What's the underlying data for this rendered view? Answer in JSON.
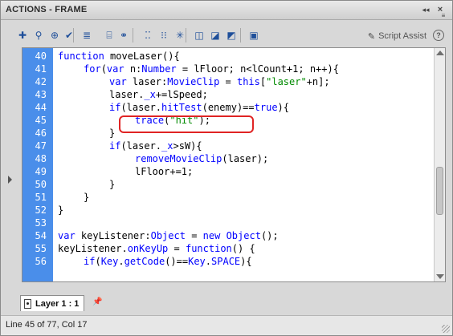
{
  "panel": {
    "title": "ACTIONS - FRAME",
    "collapse_glyph": "◂◂",
    "close_glyph": "×",
    "menu_glyph": "≡"
  },
  "toolbar": {
    "buttons": [
      {
        "name": "add-statement-icon",
        "glyph": "✚"
      },
      {
        "name": "find-icon",
        "glyph": "⚲"
      },
      {
        "name": "target-path-icon",
        "glyph": "⊕"
      },
      {
        "name": "check-syntax-icon",
        "glyph": "✔"
      },
      {
        "name": "auto-format-icon",
        "glyph": "≣"
      },
      {
        "name": "code-hint-icon",
        "glyph": "⌸"
      },
      {
        "name": "debug-options-icon",
        "glyph": "⚭"
      },
      {
        "name": "collapse-between-braces-icon",
        "glyph": "⁚⁚"
      },
      {
        "name": "collapse-selection-icon",
        "glyph": "⁝⁝"
      },
      {
        "name": "expand-all-icon",
        "glyph": "✳"
      },
      {
        "name": "apply-block-comment-icon",
        "glyph": "◫"
      },
      {
        "name": "apply-line-comment-icon",
        "glyph": "◪"
      },
      {
        "name": "remove-comment-icon",
        "glyph": "◩"
      },
      {
        "name": "show-hide-toolbox-icon",
        "glyph": "▣"
      }
    ],
    "script_assist_label": "Script Assist",
    "help_glyph": "?"
  },
  "editor": {
    "lines": [
      {
        "num": "40",
        "indent": 0,
        "html": "<span class='kw'>function</span> moveLaser(){"
      },
      {
        "num": "41",
        "indent": 1,
        "html": "<span class='kw'>for</span>(<span class='kw'>var</span> n:<span class='kw'>Number</span> = lFloor; n&lt;lCount+1; n++){"
      },
      {
        "num": "42",
        "indent": 2,
        "html": "<span class='kw'>var</span> laser:<span class='kw'>MovieClip</span> = <span class='kw'>this</span>[<span class='str'>\"laser\"</span>+n];"
      },
      {
        "num": "43",
        "indent": 2,
        "html": "laser.<span class='kw'>_x</span>+=lSpeed;"
      },
      {
        "num": "44",
        "indent": 2,
        "html": "<span class='kw'>if</span>(laser.<span class='kw'>hitTest</span>(enemy)==<span class='kw'>true</span>){"
      },
      {
        "num": "45",
        "indent": 3,
        "html": "<span class='kw'>trace</span>(<span class='str'>\"hit\"</span>);"
      },
      {
        "num": "46",
        "indent": 2,
        "html": "}"
      },
      {
        "num": "47",
        "indent": 2,
        "html": "<span class='kw'>if</span>(laser.<span class='kw'>_x</span>&gt;sW){"
      },
      {
        "num": "48",
        "indent": 3,
        "html": "<span class='kw'>removeMovieClip</span>(laser);"
      },
      {
        "num": "49",
        "indent": 3,
        "html": "lFloor+=1;"
      },
      {
        "num": "50",
        "indent": 2,
        "html": "}"
      },
      {
        "num": "51",
        "indent": 1,
        "html": "}"
      },
      {
        "num": "52",
        "indent": 0,
        "html": "}"
      },
      {
        "num": "53",
        "indent": 0,
        "html": ""
      },
      {
        "num": "54",
        "indent": 0,
        "html": "<span class='kw'>var</span> keyListener:<span class='kw'>Object</span> = <span class='kw'>new</span> <span class='kw'>Object</span>();"
      },
      {
        "num": "55",
        "indent": 0,
        "html": "keyListener.<span class='kw'>onKeyUp</span> = <span class='kw'>function</span>() {"
      },
      {
        "num": "56",
        "indent": 1,
        "html": "<span class='kw'>if</span>(<span class='kw'>Key</span>.<span class='kw'>getCode</span>()==<span class='kw'>Key</span>.<span class='kw'>SPACE</span>){"
      }
    ]
  },
  "tabs": [
    {
      "label": "Layer 1 : 1"
    }
  ],
  "status": {
    "text": "Line 45 of 77, Col 17"
  },
  "colors": {
    "gutter": "#4a8eea",
    "keyword": "#0000ff",
    "string": "#008a00",
    "highlight_box": "#e02424"
  }
}
